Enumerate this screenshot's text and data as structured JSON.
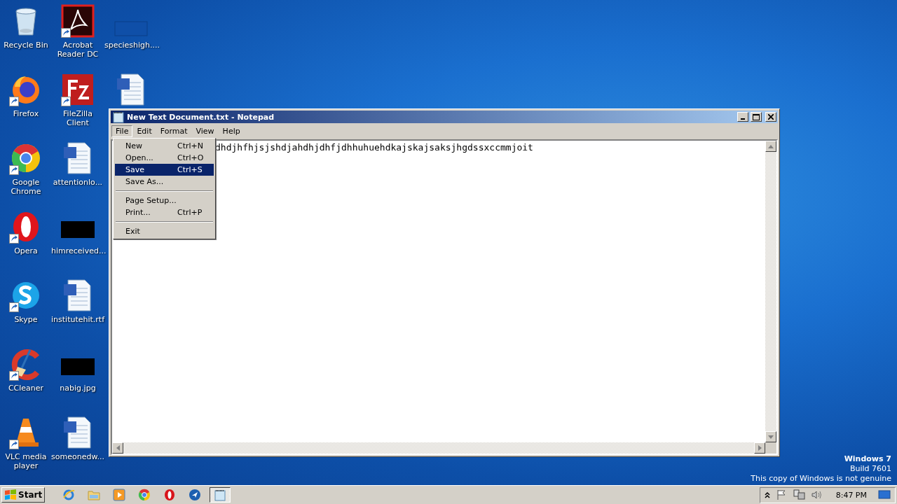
{
  "desktop": {
    "icons": [
      {
        "label": "Recycle Bin",
        "kind": "recycle"
      },
      {
        "label": "Firefox",
        "kind": "firefox",
        "shortcut": true
      },
      {
        "label": "Google Chrome",
        "kind": "chrome",
        "shortcut": true
      },
      {
        "label": "Opera",
        "kind": "opera",
        "shortcut": true
      },
      {
        "label": "Skype",
        "kind": "skype",
        "shortcut": true
      },
      {
        "label": "CCleaner",
        "kind": "ccleaner",
        "shortcut": true
      },
      {
        "label": "VLC media player",
        "kind": "vlc",
        "shortcut": true
      },
      {
        "label": "Acrobat Reader DC",
        "kind": "acrobat",
        "shortcut": true
      },
      {
        "label": "FileZilla Client",
        "kind": "filezilla",
        "shortcut": true
      },
      {
        "label": "attentionlo...",
        "kind": "word"
      },
      {
        "label": "himreceived...",
        "kind": "image"
      },
      {
        "label": "institutehit.rtf",
        "kind": "word"
      },
      {
        "label": "nabig.jpg",
        "kind": "image"
      },
      {
        "label": "someonedw...",
        "kind": "word"
      },
      {
        "label": "specieshigh....",
        "kind": "blank"
      },
      {
        "kind": "word"
      }
    ],
    "watermark": {
      "edition": "Windows 7",
      "build": "Build 7601",
      "notice": "This copy of Windows is not genuine"
    }
  },
  "window": {
    "title": "New Text Document.txt - Notepad",
    "menus": [
      {
        "label": "File",
        "selected": true
      },
      {
        "label": "Edit",
        "selected": false
      },
      {
        "label": "Format",
        "selected": false
      },
      {
        "label": "View",
        "selected": false
      },
      {
        "label": "Help",
        "selected": false
      }
    ],
    "text": "dhdjhfhjsjshdjahdhjdhfjdhhuhuehdkajskajsaksjhgdssxccmmjoit",
    "file_menu": [
      {
        "kind": "item",
        "label": "New",
        "shortcut": "Ctrl+N",
        "selected": false
      },
      {
        "kind": "item",
        "label": "Open...",
        "shortcut": "Ctrl+O",
        "selected": false
      },
      {
        "kind": "item",
        "label": "Save",
        "shortcut": "Ctrl+S",
        "selected": true
      },
      {
        "kind": "item",
        "label": "Save As...",
        "selected": false
      },
      {
        "kind": "separator"
      },
      {
        "kind": "item",
        "label": "Page Setup...",
        "selected": false
      },
      {
        "kind": "item",
        "label": "Print...",
        "shortcut": "Ctrl+P",
        "selected": false
      },
      {
        "kind": "separator"
      },
      {
        "kind": "item",
        "label": "Exit",
        "selected": false
      }
    ]
  },
  "taskbar": {
    "start": "Start",
    "buttons": [
      {
        "kind": "ie",
        "selected": false
      },
      {
        "kind": "folder",
        "selected": false
      },
      {
        "kind": "media",
        "selected": false
      },
      {
        "kind": "chrome",
        "selected": false
      },
      {
        "kind": "opera",
        "selected": false
      },
      {
        "kind": "app",
        "selected": false
      },
      {
        "kind": "notepad",
        "selected": true
      }
    ],
    "clock": "8:47 PM"
  }
}
